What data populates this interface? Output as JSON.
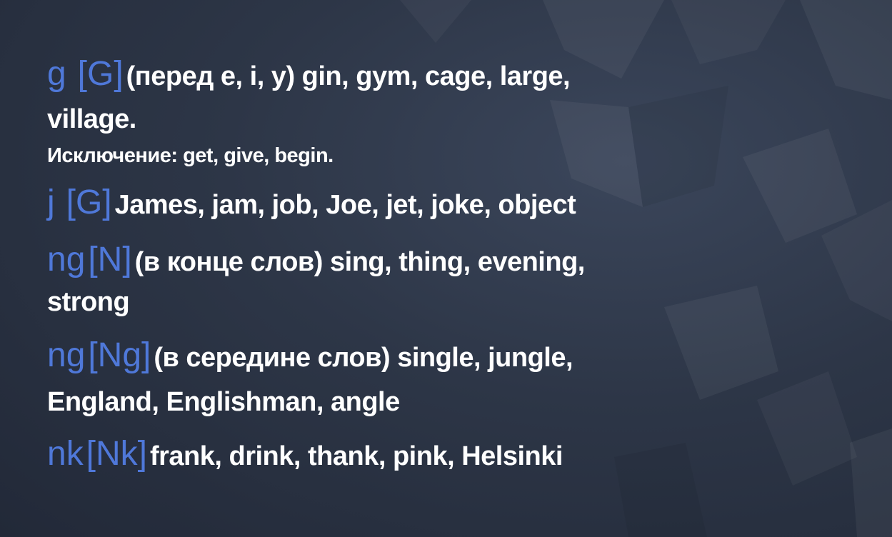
{
  "lines": {
    "g": {
      "key": "g",
      "sound": "[G]",
      "text": "(перед e, i, y) gin, gym, cage, large,",
      "cont": "village.",
      "exception": "Исключение: get, give, begin."
    },
    "j": {
      "key": "j",
      "sound": "[G]",
      "text": "James, jam, job, Joe, jet, joke, object"
    },
    "ng1": {
      "key": "ng",
      "sound": "[N]",
      "text": "(в конце слов) sing, thing, evening,",
      "cont": "strong"
    },
    "ng2": {
      "key": "ng",
      "sound": "[Ng]",
      "text": "(в середине слов) single, jungle,",
      "cont": "England, Englishman, angle"
    },
    "nk": {
      "key": "nk",
      "sound": "[Nk]",
      "text": "frank, drink, thank, pink, Helsinki"
    }
  },
  "colors": {
    "key": "#4f78d9",
    "text": "#ffffff",
    "background": "#2d3647"
  }
}
